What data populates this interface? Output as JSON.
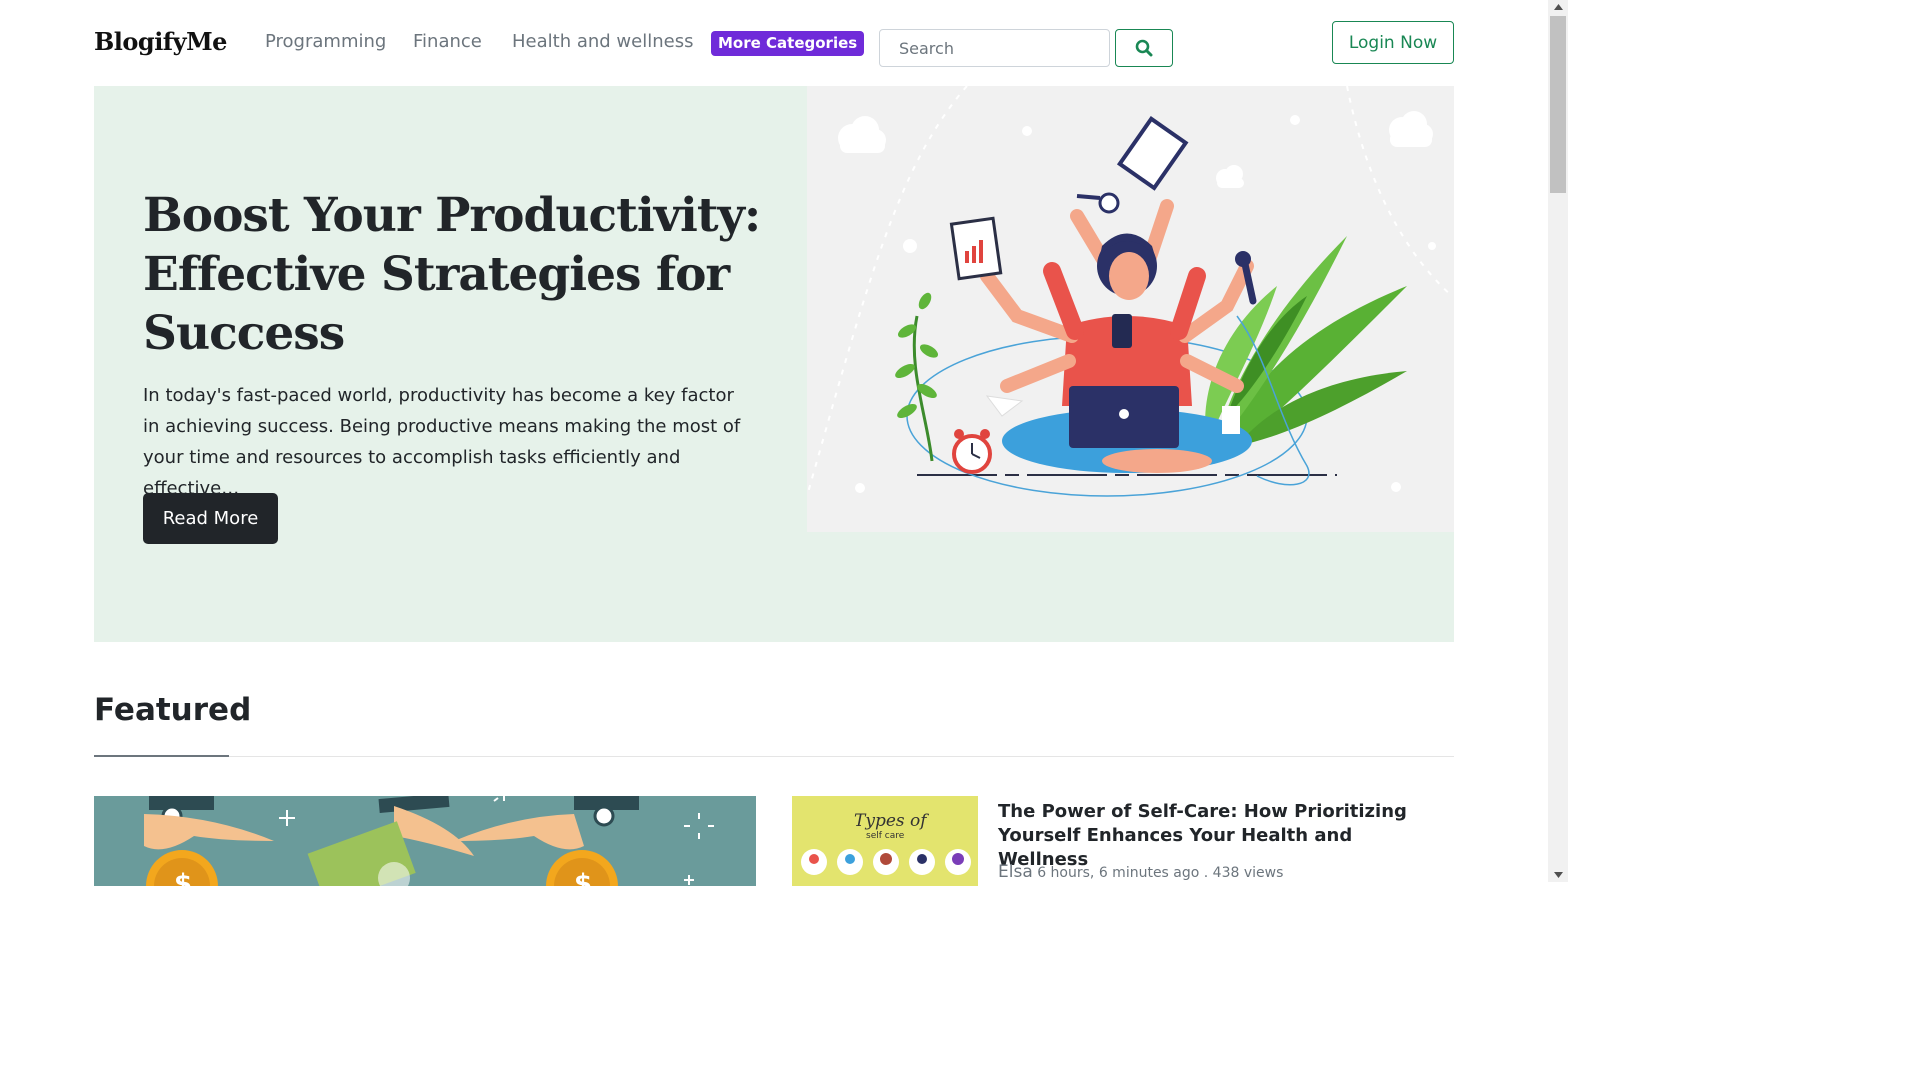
{
  "brand": "BlogifyMe",
  "nav": {
    "links": [
      "Programming",
      "Finance",
      "Health and wellness"
    ],
    "more_categories": "More Categories"
  },
  "search": {
    "placeholder": "Search",
    "icon": "search-icon"
  },
  "login": "Login Now",
  "hero": {
    "title": "Boost Your Productivity: Effective Strategies for Success",
    "text": "In today's fast-paced world, productivity has become a key factor in achieving success. Being productive means making the most of your time and resources to accomplish tasks efficiently and effective…",
    "read_more": "Read More",
    "illustration": "multitasking-woman-illustration"
  },
  "featured": {
    "heading": "Featured",
    "main_image": "money-hands-illustration",
    "items": [
      {
        "title": "The Power of Self-Care: How Prioritizing Yourself Enhances Your Health and Wellness",
        "author": "Elsa",
        "meta": "6 hours, 6 minutes ago . 438 views",
        "thumb_text_1": "Types of",
        "thumb_text_2": "self care"
      }
    ]
  },
  "colors": {
    "accent_green": "#198754",
    "more_categories_bg": "#6f2bd9",
    "hero_bg": "#e6f2ea",
    "dark_button": "#212529"
  }
}
